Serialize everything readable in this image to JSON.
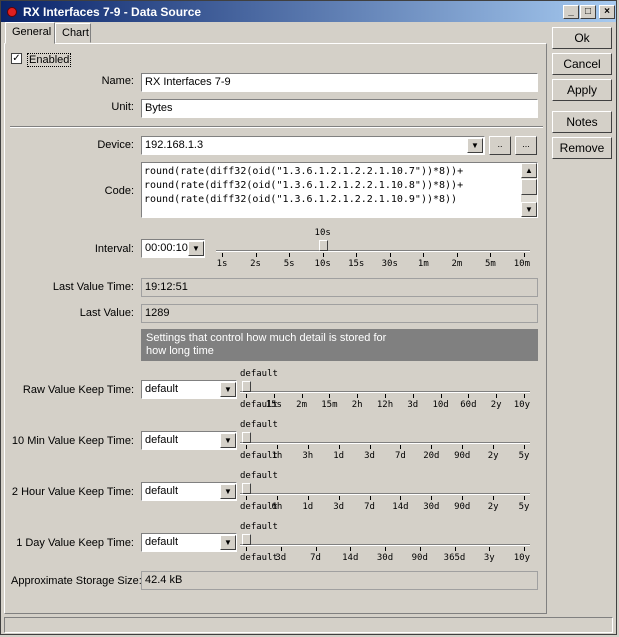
{
  "window": {
    "title": "RX Interfaces 7-9 - Data Source"
  },
  "tabs": [
    {
      "label": "General"
    },
    {
      "label": "Chart"
    }
  ],
  "enabled": {
    "label": "Enabled",
    "checked": true
  },
  "fields": {
    "name": {
      "label": "Name:",
      "value": "RX Interfaces 7-9"
    },
    "unit": {
      "label": "Unit:",
      "value": "Bytes"
    },
    "device": {
      "label": "Device:",
      "value": "192.168.1.3"
    },
    "code": {
      "label": "Code:",
      "lines": [
        "round(rate(diff32(oid(\"1.3.6.1.2.1.2.2.1.10.7\"))*8))+",
        "round(rate(diff32(oid(\"1.3.6.1.2.1.2.2.1.10.8\"))*8))+",
        "round(rate(diff32(oid(\"1.3.6.1.2.1.2.2.1.10.9\"))*8))"
      ]
    },
    "interval": {
      "label": "Interval:",
      "value": "00:00:10",
      "current": "10s",
      "ticks": [
        "1s",
        "2s",
        "5s",
        "10s",
        "15s",
        "30s",
        "1m",
        "2m",
        "5m",
        "10m"
      ]
    },
    "last_value_time": {
      "label": "Last Value Time:",
      "value": "19:12:51"
    },
    "last_value": {
      "label": "Last Value:",
      "value": "1289"
    },
    "storage": {
      "label": "Approximate Storage Size:",
      "value": "42.4 kB"
    }
  },
  "info": {
    "text": "Settings that control how much detail is stored for how long time"
  },
  "keep_times": [
    {
      "label": "Raw Value Keep Time:",
      "value": "default",
      "current": "default",
      "ticks": [
        "default",
        "15s",
        "2m",
        "15m",
        "2h",
        "12h",
        "3d",
        "10d",
        "60d",
        "2y",
        "10y"
      ]
    },
    {
      "label": "10 Min Value Keep Time:",
      "value": "default",
      "current": "default",
      "ticks": [
        "default",
        "1h",
        "3h",
        "1d",
        "3d",
        "7d",
        "20d",
        "90d",
        "2y",
        "5y"
      ]
    },
    {
      "label": "2 Hour Value Keep Time:",
      "value": "default",
      "current": "default",
      "ticks": [
        "default",
        "6h",
        "1d",
        "3d",
        "7d",
        "14d",
        "30d",
        "90d",
        "2y",
        "5y"
      ]
    },
    {
      "label": "1 Day Value Keep Time:",
      "value": "default",
      "current": "default",
      "ticks": [
        "default",
        "3d",
        "7d",
        "14d",
        "30d",
        "90d",
        "365d",
        "3y",
        "10y"
      ]
    }
  ],
  "buttons": {
    "ok": "Ok",
    "cancel": "Cancel",
    "apply": "Apply",
    "notes": "Notes",
    "remove": "Remove"
  },
  "device_buttons": {
    "browse": "..",
    "more": "..."
  },
  "icons": {
    "minimize": "minimize-icon",
    "maximize": "maximize-icon",
    "close": "close-icon"
  }
}
